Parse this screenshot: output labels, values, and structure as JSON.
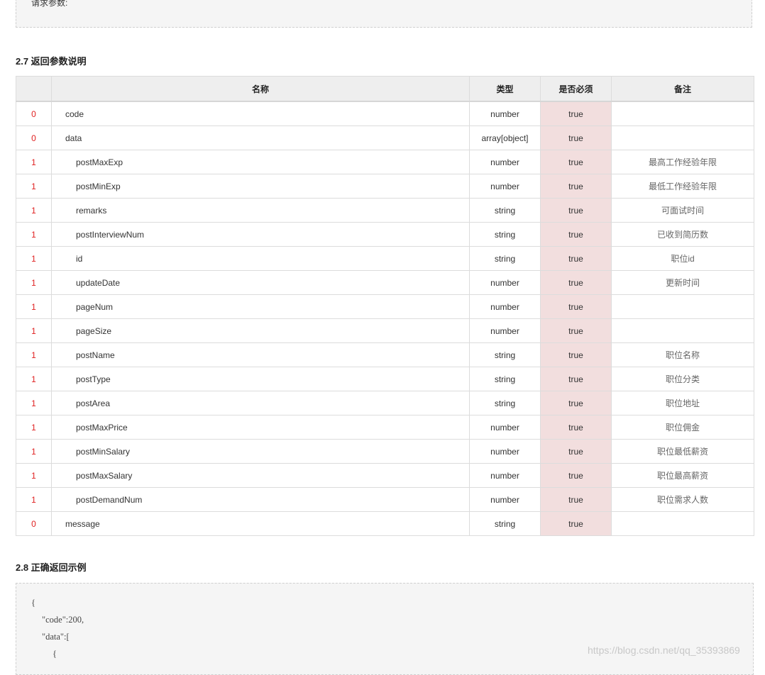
{
  "top_box": {
    "text": "请求参数:"
  },
  "section_27": {
    "title": "2.7 返回参数说明"
  },
  "table": {
    "headers": [
      "",
      "名称",
      "类型",
      "是否必须",
      "备注"
    ],
    "rows": [
      {
        "level": "0",
        "name": "code",
        "type": "number",
        "required": "true",
        "note": ""
      },
      {
        "level": "0",
        "name": "data",
        "type": "array[object]",
        "required": "true",
        "note": ""
      },
      {
        "level": "1",
        "name": "postMaxExp",
        "type": "number",
        "required": "true",
        "note": "最高工作经验年限"
      },
      {
        "level": "1",
        "name": "postMinExp",
        "type": "number",
        "required": "true",
        "note": "最低工作经验年限"
      },
      {
        "level": "1",
        "name": "remarks",
        "type": "string",
        "required": "true",
        "note": "可面试时间"
      },
      {
        "level": "1",
        "name": "postInterviewNum",
        "type": "string",
        "required": "true",
        "note": "已收到简历数"
      },
      {
        "level": "1",
        "name": "id",
        "type": "string",
        "required": "true",
        "note": "职位id"
      },
      {
        "level": "1",
        "name": "updateDate",
        "type": "number",
        "required": "true",
        "note": "更新时间"
      },
      {
        "level": "1",
        "name": "pageNum",
        "type": "number",
        "required": "true",
        "note": ""
      },
      {
        "level": "1",
        "name": "pageSize",
        "type": "number",
        "required": "true",
        "note": ""
      },
      {
        "level": "1",
        "name": "postName",
        "type": "string",
        "required": "true",
        "note": "职位名称"
      },
      {
        "level": "1",
        "name": "postType",
        "type": "string",
        "required": "true",
        "note": "职位分类"
      },
      {
        "level": "1",
        "name": "postArea",
        "type": "string",
        "required": "true",
        "note": "职位地址"
      },
      {
        "level": "1",
        "name": "postMaxPrice",
        "type": "number",
        "required": "true",
        "note": "职位佣金"
      },
      {
        "level": "1",
        "name": "postMinSalary",
        "type": "number",
        "required": "true",
        "note": "职位最低薪资"
      },
      {
        "level": "1",
        "name": "postMaxSalary",
        "type": "number",
        "required": "true",
        "note": "职位最高薪资"
      },
      {
        "level": "1",
        "name": "postDemandNum",
        "type": "number",
        "required": "true",
        "note": "职位需求人数"
      },
      {
        "level": "0",
        "name": "message",
        "type": "string",
        "required": "true",
        "note": ""
      }
    ]
  },
  "section_28": {
    "title": "2.8 正确返回示例"
  },
  "code_example": {
    "lines": [
      "{",
      "\"code\":200,",
      "\"data\":[",
      "{"
    ]
  },
  "watermark": "https://blog.csdn.net/qq_35393869"
}
